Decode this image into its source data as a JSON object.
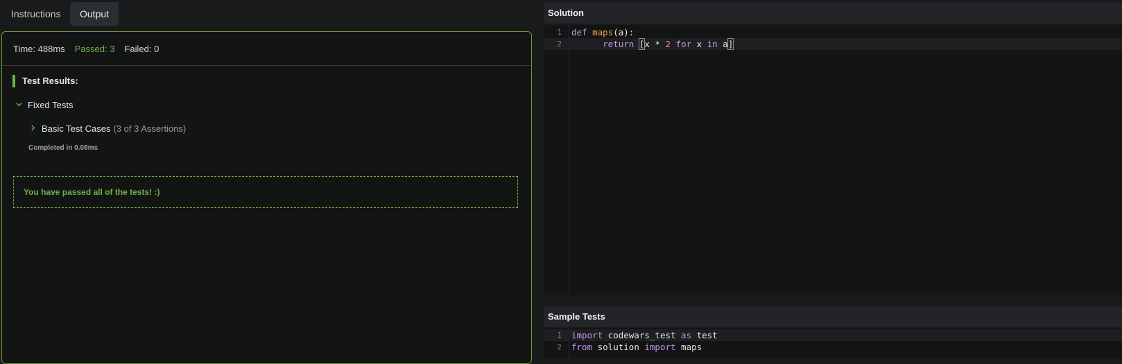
{
  "tabs": [
    {
      "label": "Instructions",
      "active": false
    },
    {
      "label": "Output",
      "active": true
    }
  ],
  "stats": {
    "time": "Time: 488ms",
    "passed": "Passed: 3",
    "failed": "Failed: 0"
  },
  "results": {
    "heading": "Test Results:",
    "group": "Fixed Tests",
    "case_name": "Basic Test Cases",
    "case_assertions": "(3 of 3 Assertions)",
    "completed": "Completed in 0.08ms",
    "pass_message": "You have passed all of the tests! :)"
  },
  "solution": {
    "title": "Solution",
    "lines": [
      {
        "num": "1",
        "kw": "def",
        "fn": "maps",
        "rest": "(a):"
      },
      {
        "num": "2",
        "kw": "return",
        "expr_open": "[",
        "x1": "x * ",
        "n": "2",
        "for": "for",
        "mid": " x ",
        "in": "in",
        "var": " a",
        "expr_close": "]"
      }
    ]
  },
  "sample_tests": {
    "title": "Sample Tests",
    "lines": [
      {
        "num": "1",
        "k1": "import",
        "t1": " codewars_test ",
        "k2": "as",
        "t2": " test"
      },
      {
        "num": "2",
        "k1": "from",
        "t1": " solution ",
        "k2": "import",
        "t2": " maps"
      }
    ]
  },
  "colors": {
    "accent_green": "#6fb244",
    "panel_border": "#6b9a33",
    "background": "#181a1b"
  }
}
